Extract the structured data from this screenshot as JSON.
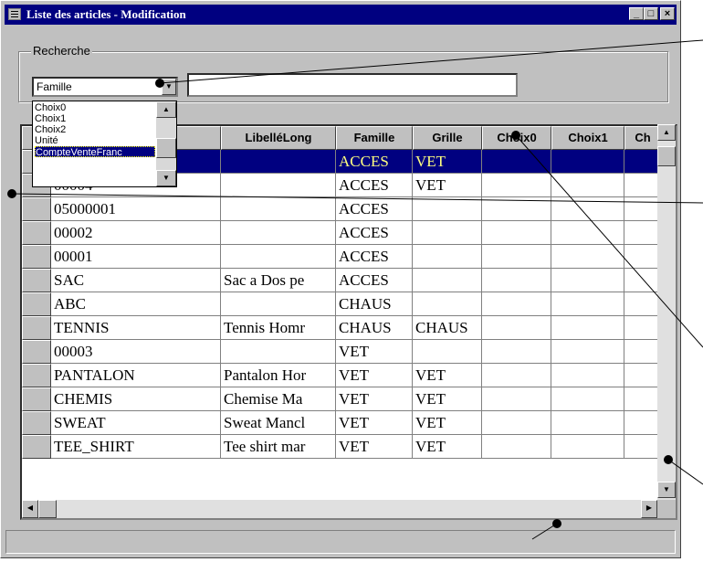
{
  "window": {
    "title": "Liste des articles - Modification",
    "minimize": "_",
    "maximize": "□",
    "close": "×"
  },
  "search": {
    "group_label": "Recherche",
    "field_value": "Famille",
    "text_value": "",
    "dropdown_options": [
      "Choix0",
      "Choix1",
      "Choix2",
      "Unité",
      "CompteVenteFranc"
    ],
    "selected_option": "CompteVenteFranc"
  },
  "table": {
    "columns": [
      "",
      "LibelléLong",
      "Famille",
      "Grille",
      "Choix0",
      "Choix1",
      "Ch"
    ],
    "rows": [
      [
        "",
        "",
        "ACCES",
        "VET",
        "",
        "",
        ""
      ],
      [
        "00004",
        "",
        "ACCES",
        "VET",
        "",
        "",
        ""
      ],
      [
        "05000001",
        "",
        "ACCES",
        "",
        "",
        "",
        ""
      ],
      [
        "00002",
        "",
        "ACCES",
        "",
        "",
        "",
        ""
      ],
      [
        "00001",
        "",
        "ACCES",
        "",
        "",
        "",
        ""
      ],
      [
        "SAC",
        "Sac a Dos pe",
        "ACCES",
        "",
        "",
        "",
        ""
      ],
      [
        "ABC",
        "",
        "CHAUS",
        "",
        "",
        "",
        ""
      ],
      [
        "TENNIS",
        "Tennis Homr",
        "CHAUS",
        "CHAUS",
        "",
        "",
        ""
      ],
      [
        "00003",
        "",
        "VET",
        "",
        "",
        "",
        ""
      ],
      [
        "PANTALON",
        "Pantalon Hor",
        "VET",
        "VET",
        "",
        "",
        ""
      ],
      [
        "CHEMIS",
        "Chemise Ma",
        "VET",
        "VET",
        "",
        "",
        ""
      ],
      [
        "SWEAT",
        "Sweat Mancl",
        "VET",
        "VET",
        "",
        "",
        ""
      ],
      [
        "TEE_SHIRT",
        "Tee shirt mar",
        "VET",
        "VET",
        "",
        "",
        ""
      ]
    ],
    "selected_row": 0
  },
  "status": {
    "text": ""
  },
  "icons": {
    "app": "list-window-icon",
    "combo_arrow": "triangle-down-icon",
    "scroll_up": "triangle-up-icon",
    "scroll_down": "triangle-down-icon",
    "scroll_left": "triangle-left-icon",
    "scroll_right": "triangle-right-icon"
  },
  "colors": {
    "titlebar": "#000080",
    "selection": "#000080",
    "selection_text": "#ffff80",
    "face": "#c0c0c0"
  }
}
